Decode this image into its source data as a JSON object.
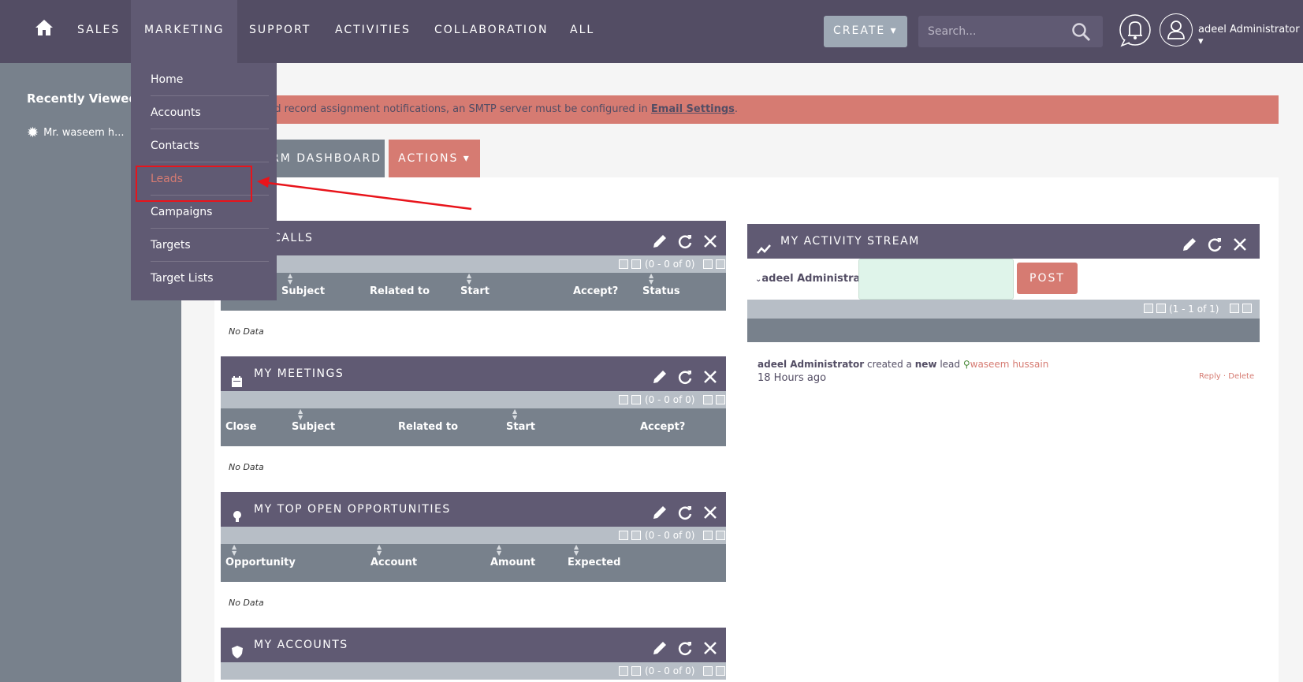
{
  "nav": {
    "items": [
      "SALES",
      "MARKETING",
      "SUPPORT",
      "ACTIVITIES",
      "COLLABORATION",
      "ALL"
    ],
    "create_label": "CREATE ▾",
    "search_placeholder": "Search...",
    "user_name": "adeel Administrator ▾"
  },
  "marketing_menu": {
    "items": [
      "Home",
      "Accounts",
      "Contacts",
      "Leads",
      "Campaigns",
      "Targets",
      "Target Lists"
    ],
    "highlighted": "Leads"
  },
  "sidebar": {
    "title": "Recently Viewed",
    "items": [
      "Mr. waseem h..."
    ]
  },
  "alert": {
    "text": "nd record assignment notifications, an SMTP server must be configured in ",
    "link": "Email Settings",
    "suffix": "."
  },
  "tabs": {
    "dashboard": "RM DASHBOARD",
    "actions": "ACTIONS ▾"
  },
  "dashlets": {
    "calls": {
      "title": "CALLS",
      "pager": "(0 - 0 of 0)",
      "columns": [
        "Subject",
        "Related to",
        "Start Date",
        "Accept?",
        "Status"
      ],
      "empty": "No Data"
    },
    "meetings": {
      "title": "MY MEETINGS",
      "pager": "(0 - 0 of 0)",
      "columns": [
        "Close",
        "Subject",
        "Related to",
        "Start Date",
        "Accept?"
      ],
      "empty": "No Data"
    },
    "opportunities": {
      "title": "MY TOP OPEN OPPORTUNITIES",
      "pager": "(0 - 0 of 0)",
      "columns": [
        "Opportunity Name",
        "Account Name",
        "Amount",
        "Expected Close Date"
      ],
      "empty": "No Data"
    },
    "accounts": {
      "title": "MY ACCOUNTS",
      "pager": "(0 - 0 of 0)"
    },
    "activity_stream": {
      "title": "MY ACTIVITY STREAM",
      "user": "adeel Administrator",
      "post_label": "POST",
      "pager": "(1 - 1 of 1)",
      "entry_user": "adeel Administrator",
      "entry_mid1": " created a ",
      "entry_new": "new",
      "entry_mid2": " lead ",
      "entry_link": "waseem hussain",
      "entry_time": "18 Hours ago",
      "reply": "Reply",
      "delete": "Delete"
    }
  },
  "colors": {
    "nav_bg": "#534d64",
    "accent": "#d67b72",
    "sidebar_bg": "#78818c",
    "annotation": "#e8141b"
  }
}
